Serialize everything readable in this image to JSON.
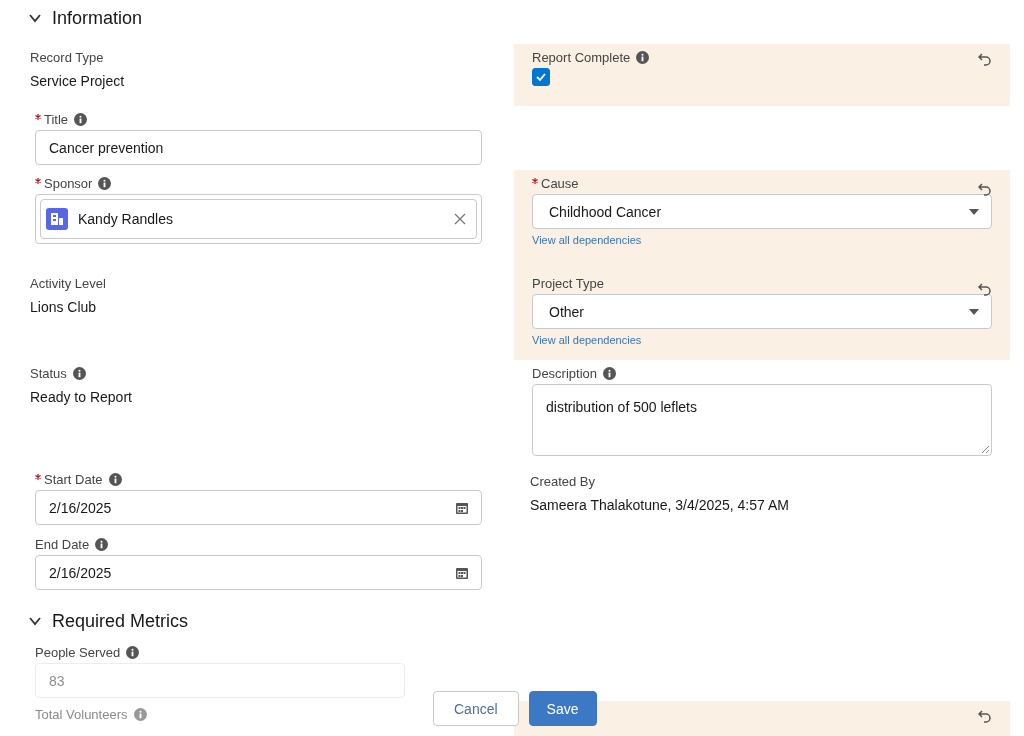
{
  "sections": [
    {
      "title": "Information",
      "expanded": true,
      "rows": [
        {
          "left": {
            "kind": "readonly",
            "label": "Record Type",
            "value": "Service Project"
          },
          "right": {
            "kind": "checkbox",
            "label": "Report Complete",
            "info": true,
            "checked": true,
            "changed": true
          }
        },
        {
          "left": {
            "kind": "text",
            "label": "Title",
            "required": true,
            "info": true,
            "value": "Cancer prevention"
          }
        },
        {
          "left": {
            "kind": "lookup",
            "label": "Sponsor",
            "required": true,
            "info": true,
            "value": "Kandy Randles"
          },
          "right": {
            "kind": "picklist",
            "label": "Cause",
            "required": true,
            "value": "Childhood Cancer",
            "link": "View all dependencies",
            "changed": true
          }
        },
        {
          "left": {
            "kind": "readonly",
            "label": "Activity Level",
            "value": "Lions Club"
          },
          "right": {
            "kind": "picklist",
            "label": "Project Type",
            "value": "Other",
            "link": "View all dependencies",
            "changed": true
          }
        },
        {
          "left": {
            "kind": "readonly",
            "label": "Status",
            "info": true,
            "value": "Ready to Report"
          },
          "right": {
            "kind": "textarea",
            "label": "Description",
            "info": true,
            "value": "distribution of 500 leflets"
          }
        },
        {
          "left": {
            "kind": "date",
            "label": "Start Date",
            "required": true,
            "info": true,
            "value": "2/16/2025"
          },
          "right": {
            "kind": "readonly",
            "label": "Created By",
            "value": "Sameera Thalakotune, 3/4/2025, 4:57 AM"
          }
        },
        {
          "left": {
            "kind": "date",
            "label": "End Date",
            "info": true,
            "value": "2/16/2025"
          }
        }
      ]
    },
    {
      "title": "Required Metrics",
      "expanded": true,
      "rows": [
        {
          "left": {
            "kind": "faded",
            "label": "People Served",
            "info": true,
            "value": "83"
          }
        },
        {
          "left": {
            "kind": "cut",
            "label": "Total Volunteers",
            "info": true
          },
          "right": {
            "kind": "cut",
            "changed": true
          }
        }
      ]
    }
  ],
  "buttons": [
    {
      "label": "Cancel",
      "kind": "neutral"
    },
    {
      "label": "Save",
      "kind": "brand"
    }
  ]
}
